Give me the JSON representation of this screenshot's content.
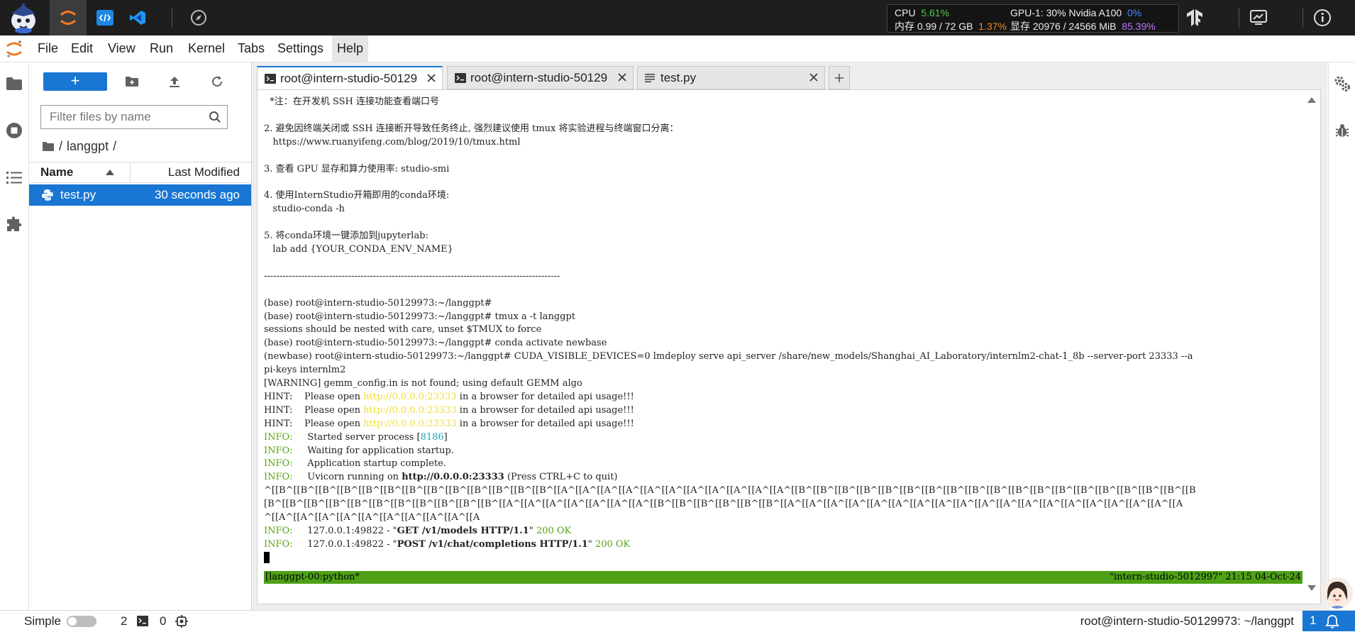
{
  "topbar": {
    "metrics": {
      "cpu_label": "CPU",
      "cpu_value": "5.61%",
      "mem_label": "内存 0.99 / 72 GB",
      "mem_value": "1.37%",
      "gpu_label": "GPU-1: 30% Nvidia A100",
      "gpu_value": "0%",
      "vram_label": "显存 20976 / 24566 MiB",
      "vram_value": "85.39%"
    }
  },
  "menu": [
    "File",
    "Edit",
    "View",
    "Run",
    "Kernel",
    "Tabs",
    "Settings",
    "Help"
  ],
  "filebrowser": {
    "new_label": "+",
    "filter_placeholder": "Filter files by name",
    "breadcrumb_sep": "/",
    "breadcrumb_dir": "langgpt",
    "breadcrumb_tail": "/",
    "col_name": "Name",
    "col_modified": "Last Modified",
    "files": [
      {
        "name": "test.py",
        "modified": "30 seconds ago"
      }
    ]
  },
  "tabs": [
    {
      "label": "root@intern-studio-50129",
      "type": "terminal"
    },
    {
      "label": "root@intern-studio-50129",
      "type": "terminal"
    },
    {
      "label": "test.py",
      "type": "file"
    }
  ],
  "terminal": {
    "l01": "  *注：在开发机 SSH 连接功能查看端口号",
    "l02": "",
    "l03": "2. 避免因终端关闭或 SSH 连接断开导致任务终止, 强烈建议使用 tmux 将实验进程与终端窗口分离：",
    "l04": "   https://www.ruanyifeng.com/blog/2019/10/tmux.html",
    "l05": "",
    "l06": "3. 查看 GPU 显存和算力使用率: studio-smi",
    "l07": "",
    "l08": "4. 使用InternStudio开箱即用的conda环境:",
    "l09": "   studio-conda -h",
    "l10": "",
    "l11": "5. 将conda环境一键添加到jupyterlab:",
    "l12": "   lab add {YOUR_CONDA_ENV_NAME}",
    "l13": "",
    "l14": "-----------------------------------------------------------------------------------------------",
    "l15": "",
    "l16": "(base) root@intern-studio-50129973:~/langgpt#",
    "l17": "(base) root@intern-studio-50129973:~/langgpt# tmux a -t langgpt",
    "l18": "sessions should be nested with care, unset $TMUX to force",
    "l19": "(base) root@intern-studio-50129973:~/langgpt# conda activate newbase",
    "l20": "(newbase) root@intern-studio-50129973:~/langgpt# CUDA_VISIBLE_DEVICES=0 lmdeploy serve api_server /share/new_models/Shanghai_AI_Laboratory/internlm2-chat-1_8b --server-port 23333 --a",
    "l21": "pi-keys internlm2",
    "l22": "[WARNING] gemm_config.in is not found; using default GEMM algo",
    "hint_prefix": "HINT:    Please open ",
    "hint_url": "http://0.0.0.0:23333",
    "hint_suffix": " in a browser for detailed api usage!!!",
    "info": "INFO:",
    "info1_a": "     Started server process [",
    "info1_pid": "8186",
    "info1_b": "]",
    "info2": "     Waiting for application startup.",
    "info3": "     Application startup complete.",
    "info4_a": "     Uvicorn running on ",
    "info4_url": "http://0.0.0.0:23333",
    "info4_b": " (Press CTRL+C to quit)",
    "esc1": "^[[B^[[B^[[B^[[B^[[B^[[B^[[B^[[B^[[B^[[B^[[B^[[B^[[B^[[A^[[A^[[A^[[A^[[A^[[A^[[A^[[A^[[A^[[A^[[A^[[B^[[B^[[B^[[B^[[B^[[B^[[B^[[B^[[B^[[B^[[B^[[B^[[B^[[B^[[B^[[B^[[B^[[B^[[B",
    "esc2": "[B^[[B^[[B^[[B^[[B^[[B^[[B^[[B^[[B^[[B^[[B^[[A^[[A^[[A^[[A^[[A^[[A^[[A^[[B^[[B^[[B^[[B^[[B^[[B^[[A^[[A^[[A^[[A^[[A^[[A^[[A^[[A^[[A^[[A^[[A^[[A^[[A^[[A^[[A^[[A^[[A^[[A^[[A",
    "esc3": "^[[A^[[A^[[A^[[A^[[A^[[A^[[A^[[A^[[A^[[A",
    "req_ip": "     127.0.0.1:49822 - \"",
    "req1": "GET /v1/models HTTP/1.1",
    "req2": "POST /v1/chat/completions HTTP/1.1",
    "req_quote": "\" ",
    "status_ok": "200 OK",
    "tmux_left": "[langgpt-00:python*",
    "tmux_right": "\"intern-studio-5012997\" 21:15 04-Oct-24"
  },
  "statusbar": {
    "simple_label": "Simple",
    "count_a": "2",
    "count_b": "0",
    "path": "root@intern-studio-50129973: ~/langgpt",
    "notifications": "1"
  },
  "colors": {
    "accent": "#1976d2",
    "tmux_status": "#4ea116",
    "info_green": "#59a313",
    "url_yellow": "#f0dd33"
  }
}
